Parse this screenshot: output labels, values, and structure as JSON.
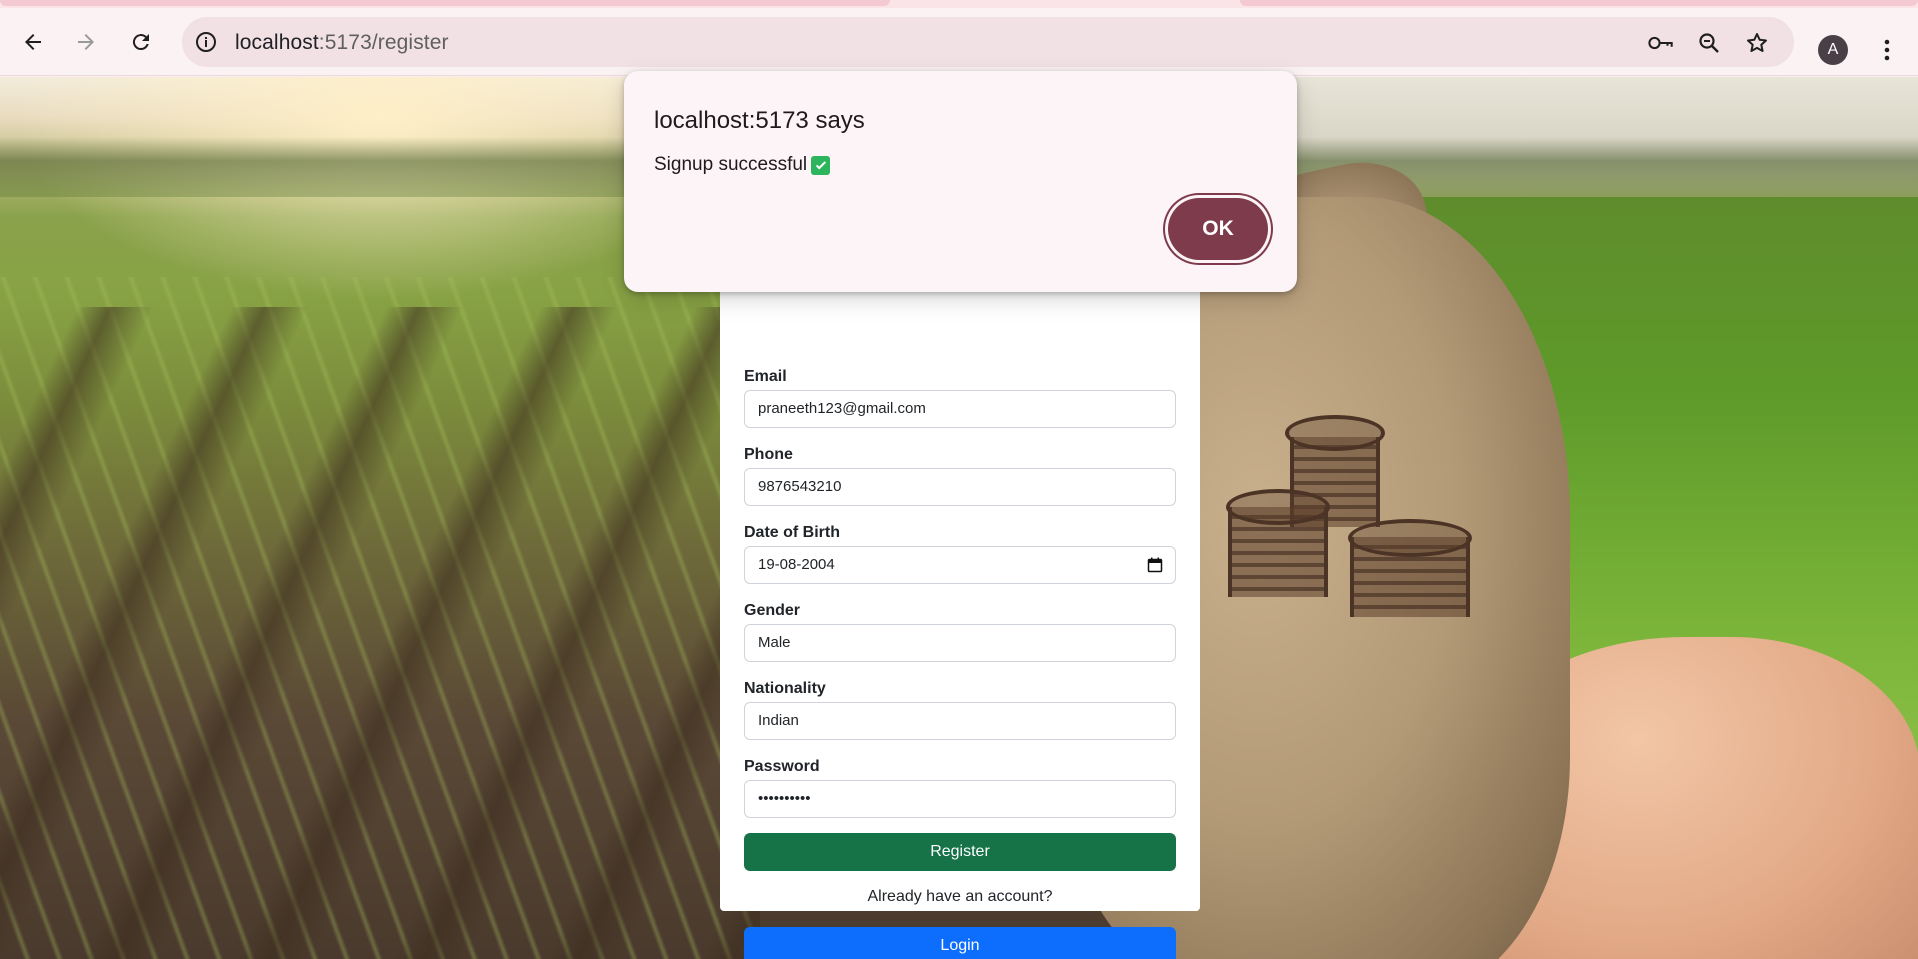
{
  "browser": {
    "url_host": "localhost",
    "url_path": ":5173/register",
    "profile_initial": "A",
    "icons": [
      "back-arrow-icon",
      "forward-arrow-icon",
      "reload-icon",
      "info-icon",
      "key-icon",
      "zoom-icon",
      "star-icon",
      "more-vert-icon"
    ]
  },
  "dialog": {
    "title": "localhost:5173 says",
    "message": "Signup successful",
    "ok_label": "OK"
  },
  "form": {
    "email": {
      "label": "Email",
      "value": "praneeth123@gmail.com"
    },
    "phone": {
      "label": "Phone",
      "value": "9876543210"
    },
    "dob": {
      "label": "Date of Birth",
      "value": "19-08-2004"
    },
    "gender": {
      "label": "Gender",
      "value": "Male"
    },
    "nationality": {
      "label": "Nationality",
      "value": "Indian"
    },
    "password": {
      "label": "Password",
      "value": "••••••••••"
    },
    "register_label": "Register",
    "already_text": "Already have an account?",
    "login_label": "Login"
  },
  "colors": {
    "register_button": "#157347",
    "login_button": "#0d6efd",
    "dialog_ok": "#7d3b4c",
    "check_badge": "#2db55d"
  }
}
